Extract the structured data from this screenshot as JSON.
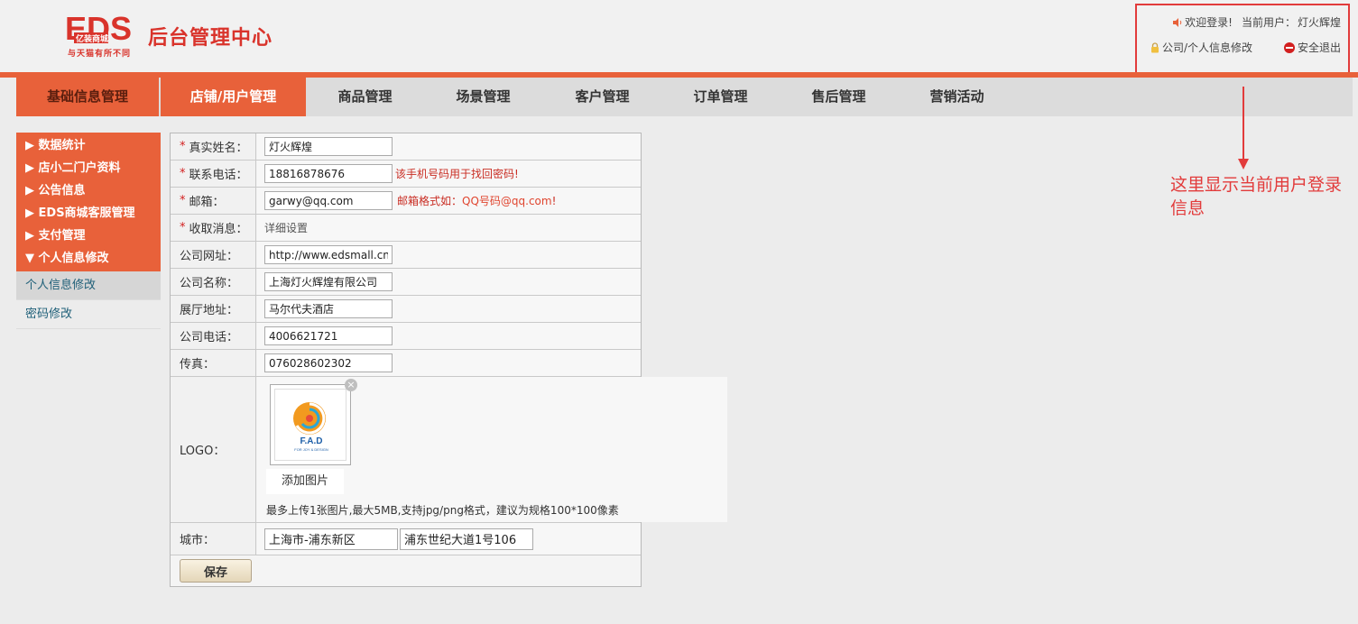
{
  "header": {
    "logo_mark": "EDS",
    "logo_sub": "亿装商城",
    "logo_tagline": "与天猫有所不同",
    "title": "后台管理中心",
    "welcome": "欢迎登录!",
    "current_user_label": "当前用户：",
    "current_user": "灯火辉煌",
    "profile_link": "公司/个人信息修改",
    "logout": "安全退出"
  },
  "nav": {
    "tabs": [
      {
        "label": "基础信息管理"
      },
      {
        "label": "店铺/用户管理"
      },
      {
        "label": "商品管理"
      },
      {
        "label": "场景管理"
      },
      {
        "label": "客户管理"
      },
      {
        "label": "订单管理"
      },
      {
        "label": "售后管理"
      },
      {
        "label": "营销活动"
      }
    ],
    "active_tab": "店铺/用户管理"
  },
  "sidebar": {
    "groups": [
      {
        "label": "▶ 数据统计"
      },
      {
        "label": "▶ 店小二门户资料"
      },
      {
        "label": "▶ 公告信息"
      },
      {
        "label": "▶ EDS商城客服管理"
      },
      {
        "label": "▶ 支付管理"
      },
      {
        "label": "▼ 个人信息修改"
      }
    ],
    "subitems": [
      {
        "label": "个人信息修改"
      },
      {
        "label": "密码修改"
      }
    ],
    "active_subitem": "个人信息修改"
  },
  "form": {
    "real_name": {
      "label": "真实姓名：",
      "value": "灯火辉煌"
    },
    "phone": {
      "label": "联系电话：",
      "value": "18816878676",
      "hint": "该手机号码用于找回密码!"
    },
    "email": {
      "label": "邮箱：",
      "value": "garwy@qq.com",
      "hint_prefix": "邮箱格式如：",
      "hint_example": "QQ号码@qq.com",
      "hint_suffix": "!"
    },
    "receive_msg": {
      "label": "收取消息：",
      "value": "详细设置"
    },
    "website": {
      "label": "公司网址：",
      "value": "http://www.edsmall.cn"
    },
    "company_name": {
      "label": "公司名称：",
      "value": "上海灯火辉煌有限公司"
    },
    "showroom": {
      "label": "展厅地址：",
      "value": "马尔代夫酒店"
    },
    "company_phone": {
      "label": "公司电话：",
      "value": "4006621721"
    },
    "fax": {
      "label": "传真：",
      "value": "076028602302"
    },
    "logo": {
      "label": "LOGO：",
      "logo_text": "F.A.D",
      "logo_caption": "FOR JOY & DESIGN",
      "add_button": "添加图片",
      "remove": "×",
      "note": "最多上传1张图片,最大5MB,支持jpg/png格式，建议为规格100*100像素"
    },
    "city": {
      "label": "城市：",
      "city_value": "上海市-浦东新区",
      "address_value": "浦东世纪大道1号106"
    },
    "required_mark": "*",
    "save_button": "保存"
  },
  "annotation": {
    "text": "这里显示当前用户登录信息"
  },
  "colors": {
    "accent": "#e8613a",
    "annotation": "#e23b3b",
    "hint": "#c92d23"
  }
}
